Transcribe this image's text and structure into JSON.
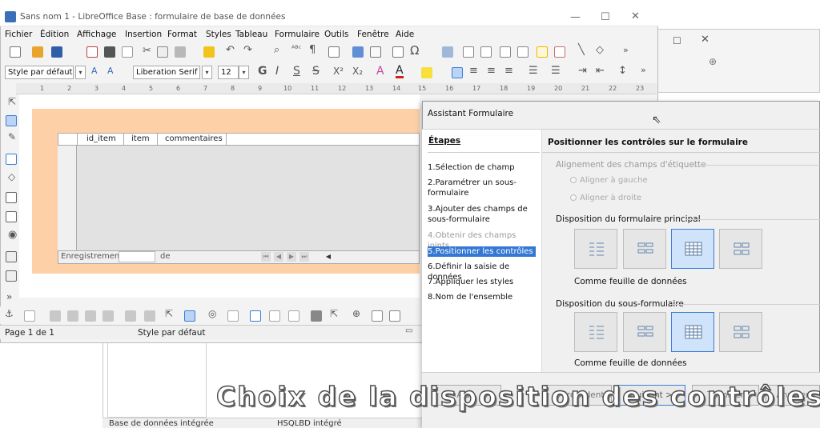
{
  "main_window": {
    "title": "Sans nom 1 - LibreOffice Base : formulaire de base de données",
    "controls": {
      "minimize": "—",
      "maximize": "☐",
      "close": "✕"
    }
  },
  "menu": [
    "Fichier",
    "Édition",
    "Affichage",
    "Insertion",
    "Format",
    "Styles",
    "Tableau",
    "Formulaire",
    "Outils",
    "Fenêtre",
    "Aide"
  ],
  "format_toolbar": {
    "paragraph_style": "Style par défaut",
    "font_name": "Liberation Serif",
    "font_size": "12"
  },
  "ruler": [
    "1",
    "2",
    "3",
    "4",
    "5",
    "6",
    "7",
    "8",
    "9",
    "10",
    "11",
    "12",
    "13",
    "14",
    "15",
    "16",
    "17",
    "18",
    "19",
    "20",
    "21",
    "22",
    "23"
  ],
  "grid": {
    "columns": [
      "id_item",
      "item",
      "commentaires"
    ],
    "nav_label": "Enregistrement",
    "nav_of": "de"
  },
  "status": {
    "page": "Page 1 de 1",
    "style": "Style par défaut"
  },
  "back_window": {
    "status_left": "Base de données intégrée",
    "status_right": "HSQLBD intégré",
    "controls": {
      "maximize": "☐",
      "close": "✕"
    }
  },
  "dialog": {
    "title": "Assistant Formulaire",
    "steps_title": "Étapes",
    "steps": [
      "1.Sélection de champ",
      "2.Paramétrer un sous-formulaire",
      "3.Ajouter des champs de sous-formulaire",
      "4.Obtenir des champs joints",
      "5.Positionner les contrôles",
      "6.Définir la saisie de données",
      "7.Appliquer les styles",
      "8.Nom de l'ensemble"
    ],
    "content_title": "Positionner les contrôles sur le formulaire",
    "label_alignment": {
      "title": "Alignement des champs d'étiquette",
      "left": "Aligner à gauche",
      "right": "Aligner à droite"
    },
    "main_layout": {
      "title": "Disposition du formulaire principal",
      "caption": "Comme feuille de données"
    },
    "sub_layout": {
      "title": "Disposition du sous-formulaire",
      "caption": "Comme feuille de données"
    },
    "buttons": {
      "help": "Aide",
      "prev": "< Précédent",
      "next": "Suivant >",
      "finish": "Terminer",
      "cancel": "Annuler"
    }
  },
  "subtitle": "Choix de la disposition des contrôles"
}
